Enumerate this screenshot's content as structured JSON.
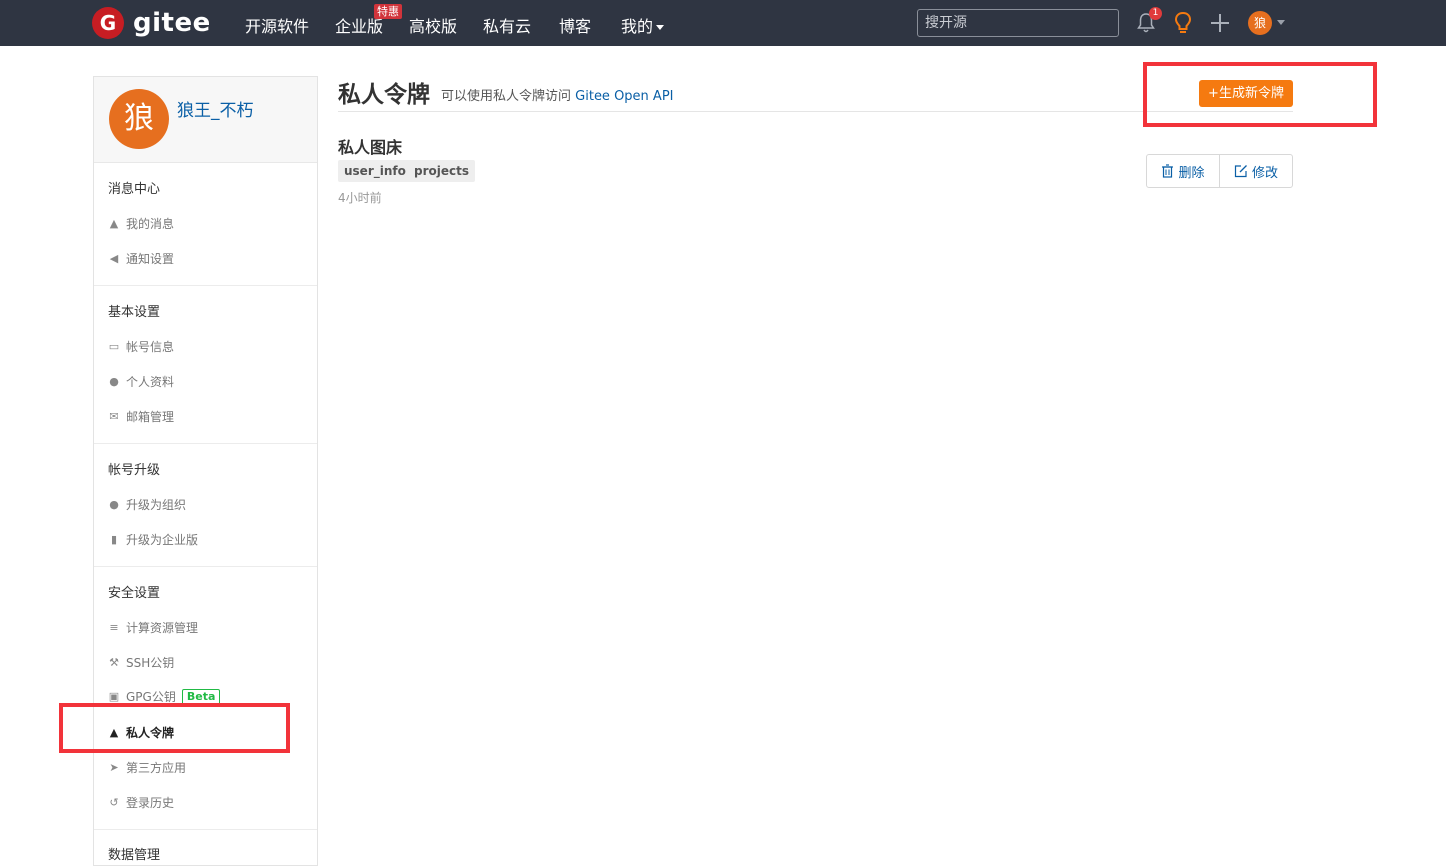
{
  "nav": {
    "logo_text": "gitee",
    "logo_mark": "G",
    "items": [
      "开源软件",
      "企业版",
      "高校版",
      "私有云",
      "博客",
      "我的"
    ],
    "special_badge": "特惠",
    "search_placeholder": "搜开源",
    "notification_count": "1",
    "avatar_char": "狼"
  },
  "sidebar": {
    "avatar_char": "狼",
    "username": "狼王_不朽",
    "sections": [
      {
        "title": "消息中心",
        "items": [
          "我的消息",
          "通知设置"
        ]
      },
      {
        "title": "基本设置",
        "items": [
          "帐号信息",
          "个人资料",
          "邮箱管理"
        ]
      },
      {
        "title": "帐号升级",
        "items": [
          "升级为组织",
          "升级为企业版"
        ]
      },
      {
        "title": "安全设置",
        "items": [
          "计算资源管理",
          "SSH公钥",
          "GPG公钥",
          "私人令牌",
          "第三方应用",
          "登录历史"
        ]
      },
      {
        "title": "数据管理",
        "items": []
      }
    ],
    "beta_label": "Beta"
  },
  "main": {
    "title": "私人令牌",
    "description": "可以使用私人令牌访问",
    "api_link": "Gitee Open API",
    "generate_button": "+生成新令牌",
    "token": {
      "name": "私人图床",
      "scopes": [
        "user_info",
        "projects"
      ],
      "time": "4小时前",
      "delete_label": "删除",
      "edit_label": "修改"
    }
  },
  "colors": {
    "nav_bg": "#2f3542",
    "accent_orange": "#f57a10",
    "link_blue": "#0a5fa6",
    "highlight_red": "#f2333a",
    "beta_green": "#21ba45"
  }
}
